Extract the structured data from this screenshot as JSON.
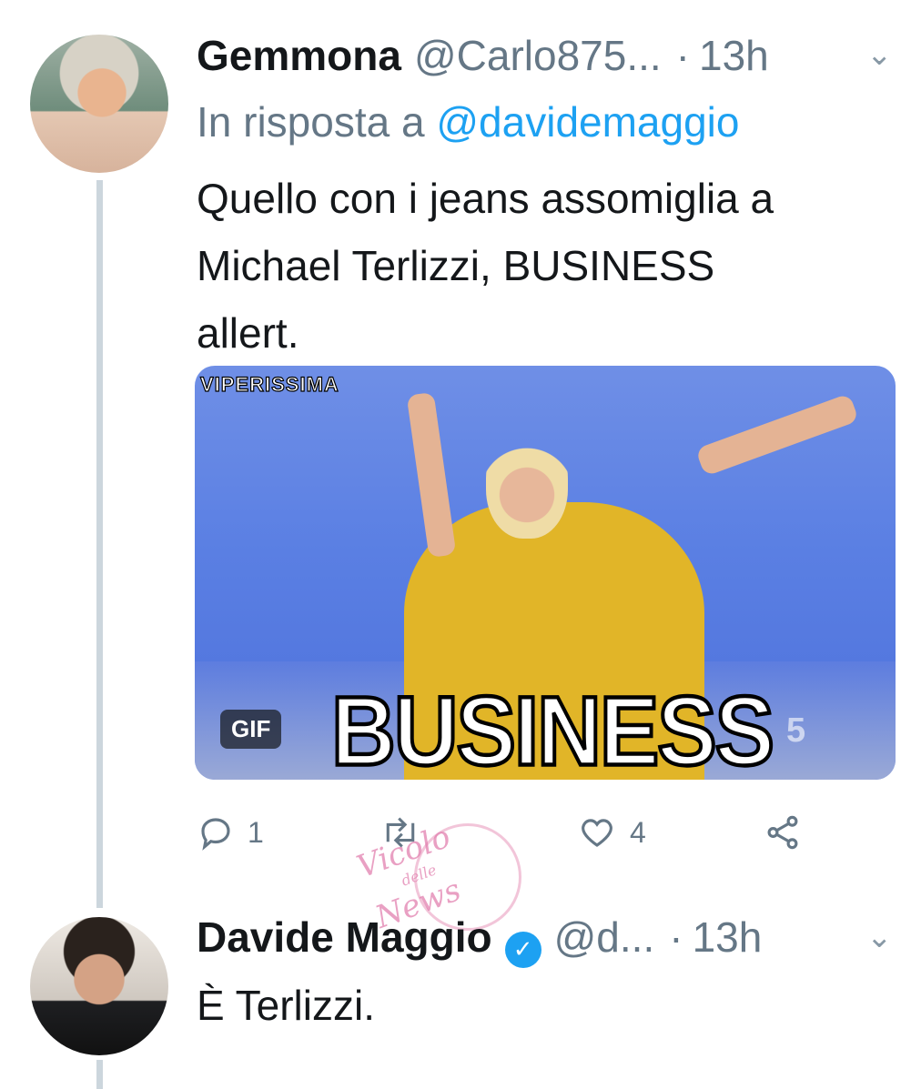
{
  "tweet1": {
    "name": "Gemmona",
    "handle": "@Carlo875...",
    "time": "13h",
    "reply_prefix": "In risposta a ",
    "reply_mention": "@davidemaggio",
    "text_lines": [
      "Quello con i jeans assomiglia a",
      "Michael Terlizzi, BUSINESS",
      "allert."
    ],
    "media": {
      "overlay_top": "VIPERISSIMA",
      "overlay_caption": "BUSINESS",
      "badge": "GIF",
      "channel_logo": "5"
    },
    "actions": {
      "reply_count": "1",
      "retweet_count": "",
      "like_count": "4"
    }
  },
  "tweet2": {
    "name": "Davide Maggio",
    "handle": "@d...",
    "time": "13h",
    "text": "È Terlizzi."
  },
  "watermark": {
    "text1": "Vicolo",
    "text2": "delle",
    "text3": "News"
  },
  "colors": {
    "accent": "#1da1f2",
    "muted": "#657786",
    "thread_line": "#ccd6dd"
  },
  "icons": [
    "reply-icon",
    "retweet-icon",
    "like-icon",
    "share-icon",
    "chevron-down-icon",
    "verified-icon"
  ]
}
